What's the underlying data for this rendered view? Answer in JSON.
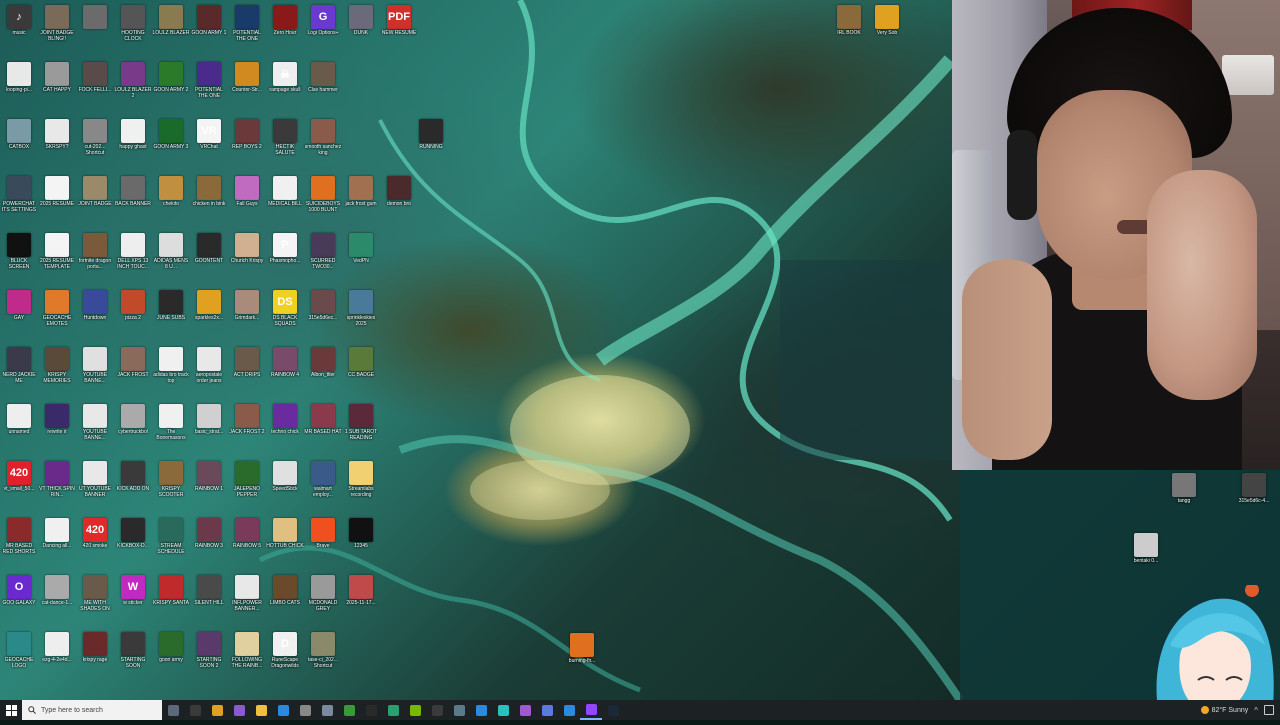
{
  "desktop": {
    "icons": [
      {
        "label": "music",
        "color": "#3a3a3a",
        "glyph": "♪"
      },
      {
        "label": "JOINT BADGE BLING!!",
        "color": "#7a6a5a",
        "glyph": ""
      },
      {
        "label": "",
        "color": "#6b6b6b",
        "glyph": ""
      },
      {
        "label": "HOOTING CLOCK",
        "color": "#555",
        "glyph": ""
      },
      {
        "label": "LOULZ BLAZER",
        "color": "#8a7a50",
        "glyph": ""
      },
      {
        "label": "GOON ARMY 1",
        "color": "#5a2a2a",
        "glyph": ""
      },
      {
        "label": "POTENTIAL THE ONE",
        "color": "#1a3a6a",
        "glyph": ""
      },
      {
        "label": "Zero Hour",
        "color": "#8a1a1a",
        "glyph": ""
      },
      {
        "label": "Logi Options+",
        "color": "#6a3ad0",
        "glyph": "G"
      },
      {
        "label": "DUNK",
        "color": "#6a6a7a",
        "glyph": ""
      },
      {
        "label": "NEW RESUME",
        "color": "#d0302a",
        "glyph": "PDF"
      },
      {
        "label": "IRL BOOK",
        "color": "#8a6a3a",
        "glyph": ""
      },
      {
        "label": "Very Sob",
        "color": "#e0a020",
        "glyph": ""
      },
      {
        "label": "looping-pi...",
        "color": "#e8e8e8",
        "glyph": ""
      },
      {
        "label": "CAT HAPPY",
        "color": "#9a9a9a",
        "glyph": ""
      },
      {
        "label": "FOCK FELLI...",
        "color": "#5a4a4a",
        "glyph": ""
      },
      {
        "label": "LOULZ BLAZER 2",
        "color": "#7a3a8a",
        "glyph": ""
      },
      {
        "label": "GOON ARMY 2",
        "color": "#2a7a2a",
        "glyph": ""
      },
      {
        "label": "POTENTIAL THE ONE",
        "color": "#4a2a8a",
        "glyph": ""
      },
      {
        "label": "Counter-Str...",
        "color": "#d08a20",
        "glyph": ""
      },
      {
        "label": "rampage skull",
        "color": "#eee",
        "glyph": "☠"
      },
      {
        "label": "Clav hammer",
        "color": "#6a5a4a",
        "glyph": ""
      },
      {
        "label": "CATBOX",
        "color": "#7a9aa8",
        "glyph": ""
      },
      {
        "label": "SKRSPY?",
        "color": "#e8e8e8",
        "glyph": ""
      },
      {
        "label": "cut-202... Shortcut",
        "color": "#888",
        "glyph": ""
      },
      {
        "label": "happy ghast",
        "color": "#f0f0f0",
        "glyph": ""
      },
      {
        "label": "GOON ARMY 3",
        "color": "#1a6a2a",
        "glyph": ""
      },
      {
        "label": "VRChat",
        "color": "#f4f4f4",
        "glyph": "VR"
      },
      {
        "label": "REP BOYS 2",
        "color": "#6a3a3a",
        "glyph": ""
      },
      {
        "label": "HECTIK SALUTE",
        "color": "#3a3a3a",
        "glyph": ""
      },
      {
        "label": "smooth sanchez king",
        "color": "#8a5a4a",
        "glyph": ""
      },
      {
        "label": "RUNNING",
        "color": "#2a2a2a",
        "glyph": ""
      },
      {
        "label": "POWERCHAT ITS SETTINGS",
        "color": "#3a4a5a",
        "glyph": ""
      },
      {
        "label": "2025 RESUME",
        "color": "#f4f4f4",
        "glyph": ""
      },
      {
        "label": "JOINT BADGE",
        "color": "#9a8a6a",
        "glyph": ""
      },
      {
        "label": "BACK BANNER",
        "color": "#6a6a6a",
        "glyph": ""
      },
      {
        "label": "chekito",
        "color": "#c09040",
        "glyph": ""
      },
      {
        "label": "chicken in bink",
        "color": "#8a6a3a",
        "glyph": ""
      },
      {
        "label": "Fall Guys",
        "color": "#c06ac0",
        "glyph": ""
      },
      {
        "label": "MEDICAL BILL",
        "color": "#f0f0f0",
        "glyph": ""
      },
      {
        "label": "SUICIDEBOYS 1000 BLUNT",
        "color": "#e07020",
        "glyph": ""
      },
      {
        "label": "jack frost gum",
        "color": "#a07050",
        "glyph": ""
      },
      {
        "label": "demon bro",
        "color": "#4a2a2a",
        "glyph": ""
      },
      {
        "label": "BLUCK SCREEN",
        "color": "#111",
        "glyph": ""
      },
      {
        "label": "2025 RESUME TEMPLATE",
        "color": "#f4f4f4",
        "glyph": ""
      },
      {
        "label": "fortnite dragon porta...",
        "color": "#7a5a3a",
        "glyph": ""
      },
      {
        "label": "DELL XPS 13 INCH TOUC...",
        "color": "#eee",
        "glyph": ""
      },
      {
        "label": "ADIDAS MENS 8 U...",
        "color": "#ddd",
        "glyph": ""
      },
      {
        "label": "GOONTENT",
        "color": "#2a2a2a",
        "glyph": ""
      },
      {
        "label": "Churich Krispy",
        "color": "#d0b090",
        "glyph": ""
      },
      {
        "label": "Phasmopho...",
        "color": "#f4f4f4",
        "glyph": "P"
      },
      {
        "label": "SCURRED TWO30...",
        "color": "#4a3a5a",
        "glyph": ""
      },
      {
        "label": "VedPN",
        "color": "#2a8a6a",
        "glyph": ""
      },
      {
        "label": "GAY",
        "color": "#c02a8a",
        "glyph": ""
      },
      {
        "label": "GEOCACHE EMOTES",
        "color": "#e07a2a",
        "glyph": ""
      },
      {
        "label": "Huntdown",
        "color": "#3a4a9a",
        "glyph": ""
      },
      {
        "label": "pizza 2",
        "color": "#c04a2a",
        "glyph": ""
      },
      {
        "label": "JUNE SUBS",
        "color": "#2a2a2a",
        "glyph": ""
      },
      {
        "label": "sparkles2x...",
        "color": "#e0a020",
        "glyph": ""
      },
      {
        "label": "Grimdark...",
        "color": "#aa8a7a",
        "glyph": ""
      },
      {
        "label": "DS BLACK SQUADS",
        "color": "#f0d020",
        "glyph": "DS"
      },
      {
        "label": "315e5d6ec...",
        "color": "#6a4a4a",
        "glyph": ""
      },
      {
        "label": "sprinkleskies 2025",
        "color": "#4a7a9a",
        "glyph": ""
      },
      {
        "label": "NERD JACKIE ME",
        "color": "#3a3a4a",
        "glyph": ""
      },
      {
        "label": "KRISPY MEMORIES",
        "color": "#5a4a3a",
        "glyph": ""
      },
      {
        "label": "YOUTUBE BANNE...",
        "color": "#e0e0e0",
        "glyph": ""
      },
      {
        "label": "JACK FROST",
        "color": "#8a6a5a",
        "glyph": ""
      },
      {
        "label": "adidas bro track top",
        "color": "#f0f0f0",
        "glyph": ""
      },
      {
        "label": "aeropostale order jeans",
        "color": "#e8e8e8",
        "glyph": ""
      },
      {
        "label": "ACT DRIPS",
        "color": "#6a5a4a",
        "glyph": ""
      },
      {
        "label": "RAINBOW 4",
        "color": "#7a4a6a",
        "glyph": ""
      },
      {
        "label": "Albon_ttler",
        "color": "#6a3a3a",
        "glyph": ""
      },
      {
        "label": "CC BADGE",
        "color": "#5a7a3a",
        "glyph": ""
      },
      {
        "label": "unnamed",
        "color": "#eee",
        "glyph": ""
      },
      {
        "label": "rewrite ir",
        "color": "#3a2a6a",
        "glyph": ""
      },
      {
        "label": "YOUTUBE BANNE...",
        "color": "#e8e8e8",
        "glyph": ""
      },
      {
        "label": "cybertruckbol",
        "color": "#aaa",
        "glyph": ""
      },
      {
        "label": "The Bonemasons",
        "color": "#f0f0f0",
        "glyph": ""
      },
      {
        "label": "basic_strat...",
        "color": "#d0d0d0",
        "glyph": ""
      },
      {
        "label": "JACK FROST 2",
        "color": "#8a5a4a",
        "glyph": ""
      },
      {
        "label": "techno chick",
        "color": "#6a2aa0",
        "glyph": ""
      },
      {
        "label": "MR BASED HAT",
        "color": "#8a3a4a",
        "glyph": ""
      },
      {
        "label": "1 SUB TAROT READING",
        "color": "#5a2a3a",
        "glyph": ""
      },
      {
        "label": "vt_small_50...",
        "color": "#e0202a",
        "glyph": "420"
      },
      {
        "label": "VT THICK SPIN RIN...",
        "color": "#6a2a8a",
        "glyph": ""
      },
      {
        "label": "UT YOUTUBE BANNER",
        "color": "#e8e8e8",
        "glyph": ""
      },
      {
        "label": "KICK ADD ON",
        "color": "#3a3a3a",
        "glyph": ""
      },
      {
        "label": "KRISPY SCOOTER",
        "color": "#8a6a3a",
        "glyph": ""
      },
      {
        "label": "RAINBOW 1",
        "color": "#6a4a5a",
        "glyph": ""
      },
      {
        "label": "JALEPENO PEPPER",
        "color": "#2a6a2a",
        "glyph": ""
      },
      {
        "label": "SpeedStick",
        "color": "#e0e0e0",
        "glyph": ""
      },
      {
        "label": "walmart employ...",
        "color": "#3a5a8a",
        "glyph": ""
      },
      {
        "label": "Streamlabs recording",
        "color": "#f0d070",
        "glyph": ""
      },
      {
        "label": "MR BASED RED SHORTS",
        "color": "#8a2a2a",
        "glyph": ""
      },
      {
        "label": "Dancing all...",
        "color": "#f0f0f0",
        "glyph": ""
      },
      {
        "label": "420 smoke",
        "color": "#e02a2a",
        "glyph": "420"
      },
      {
        "label": "KICKBOX-D...",
        "color": "#2a2a2a",
        "glyph": ""
      },
      {
        "label": "STREAM SCHEDULE",
        "color": "#2a6a5a",
        "glyph": ""
      },
      {
        "label": "RAINBOW 3",
        "color": "#6a3a4a",
        "glyph": ""
      },
      {
        "label": "RAINBOW 5",
        "color": "#7a3a5a",
        "glyph": ""
      },
      {
        "label": "HOTTUB CHICK",
        "color": "#e0c080",
        "glyph": ""
      },
      {
        "label": "Brave",
        "color": "#f05020",
        "glyph": ""
      },
      {
        "label": "12345",
        "color": "#111",
        "glyph": ""
      },
      {
        "label": "GOO GALAXY",
        "color": "#6a2ad0",
        "glyph": "O"
      },
      {
        "label": "cat-dance-1...",
        "color": "#aaa",
        "glyph": ""
      },
      {
        "label": "ME WITH SHADES ON",
        "color": "#6a5a4a",
        "glyph": ""
      },
      {
        "label": "w sticker",
        "color": "#c02ac0",
        "glyph": "W"
      },
      {
        "label": "KRISPY SANTA",
        "color": "#c02a2a",
        "glyph": ""
      },
      {
        "label": "SILENT HILL",
        "color": "#4a4a4a",
        "glyph": ""
      },
      {
        "label": "INFLPOWER BANNER...",
        "color": "#e8e8e8",
        "glyph": ""
      },
      {
        "label": "LIMBO CATS",
        "color": "#6a4a2a",
        "glyph": ""
      },
      {
        "label": "MCDONALD GREY",
        "color": "#9a9a9a",
        "glyph": ""
      },
      {
        "label": "2025-11-17...",
        "color": "#c04a4a",
        "glyph": ""
      },
      {
        "label": "GEOCACHE LOGO",
        "color": "#2a8a8a",
        "glyph": ""
      },
      {
        "label": "ezg-4-2e4d...",
        "color": "#eee",
        "glyph": ""
      },
      {
        "label": "krispy rage",
        "color": "#6a2a2a",
        "glyph": ""
      },
      {
        "label": "STARTING SOON",
        "color": "#3a3a3a",
        "glyph": ""
      },
      {
        "label": "goon army",
        "color": "#2a6a2a",
        "glyph": ""
      },
      {
        "label": "STARTING SOON 2",
        "color": "#5a3a6a",
        "glyph": ""
      },
      {
        "label": "FOLLOWING THE RAINB...",
        "color": "#e0d0a0",
        "glyph": ""
      },
      {
        "label": "RuneScape Dragonwilds",
        "color": "#f0f0f0",
        "glyph": "D"
      },
      {
        "label": "tase-ci_202... Shortcut",
        "color": "#8a8a6a",
        "glyph": ""
      },
      {
        "label": "burning-fir...",
        "color": "#e07020",
        "glyph": ""
      },
      {
        "label": "tangg",
        "color": "#777",
        "glyph": ""
      },
      {
        "label": "315e5d6c-4...",
        "color": "#444",
        "glyph": ""
      },
      {
        "label": "bentaki 0...",
        "color": "#ccc",
        "glyph": ""
      }
    ]
  },
  "taskbar": {
    "search_placeholder": "Type here to search",
    "pinned": [
      {
        "name": "task-view",
        "color": "#5a6a7a"
      },
      {
        "name": "game-app",
        "color": "#3a3a3a"
      },
      {
        "name": "chrome",
        "color": "#e0a020"
      },
      {
        "name": "obs",
        "color": "#8a5ad0"
      },
      {
        "name": "files",
        "color": "#f0c040"
      },
      {
        "name": "edge",
        "color": "#2a8ae0"
      },
      {
        "name": "obs-studio",
        "color": "#888"
      },
      {
        "name": "steam",
        "color": "#7a8aa0"
      },
      {
        "name": "notepad",
        "color": "#3a9a3a"
      },
      {
        "name": "app-dark",
        "color": "#2a2a2a"
      },
      {
        "name": "discord",
        "color": "#2aa070"
      },
      {
        "name": "nvidia",
        "color": "#76b900"
      },
      {
        "name": "terminal",
        "color": "#3a3a3a"
      },
      {
        "name": "calculator",
        "color": "#5a7a8a"
      },
      {
        "name": "notes",
        "color": "#2a8ae0"
      },
      {
        "name": "browser",
        "color": "#2ac0c0"
      },
      {
        "name": "vtube",
        "color": "#a05ad0"
      },
      {
        "name": "messages",
        "color": "#5a7ae0"
      },
      {
        "name": "store",
        "color": "#2a8ae0"
      },
      {
        "name": "twitch",
        "color": "#9146ff"
      },
      {
        "name": "steam-2",
        "color": "#1b2838"
      }
    ],
    "weather": "82°F  Sunny"
  }
}
